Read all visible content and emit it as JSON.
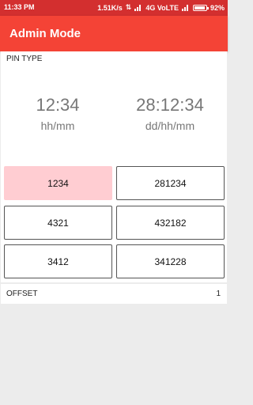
{
  "status_bar": {
    "time": "11:33 PM",
    "network_speed": "1.51K/s",
    "network_type": "4G VoLTE",
    "battery": "92%",
    "battery_level": 0.92
  },
  "app_bar": {
    "title": "Admin Mode",
    "color": "#f44336"
  },
  "pin_type": {
    "label": "PIN TYPE",
    "short_time": "12:34",
    "short_format": "hh/mm",
    "long_time": "28:12:34",
    "long_format": "dd/hh/mm"
  },
  "pins": [
    {
      "value": "1234",
      "selected": true
    },
    {
      "value": "281234",
      "selected": false
    },
    {
      "value": "4321",
      "selected": false
    },
    {
      "value": "432182",
      "selected": false
    },
    {
      "value": "3412",
      "selected": false
    },
    {
      "value": "341228",
      "selected": false
    }
  ],
  "offset": {
    "label": "OFFSET",
    "value": "1"
  }
}
